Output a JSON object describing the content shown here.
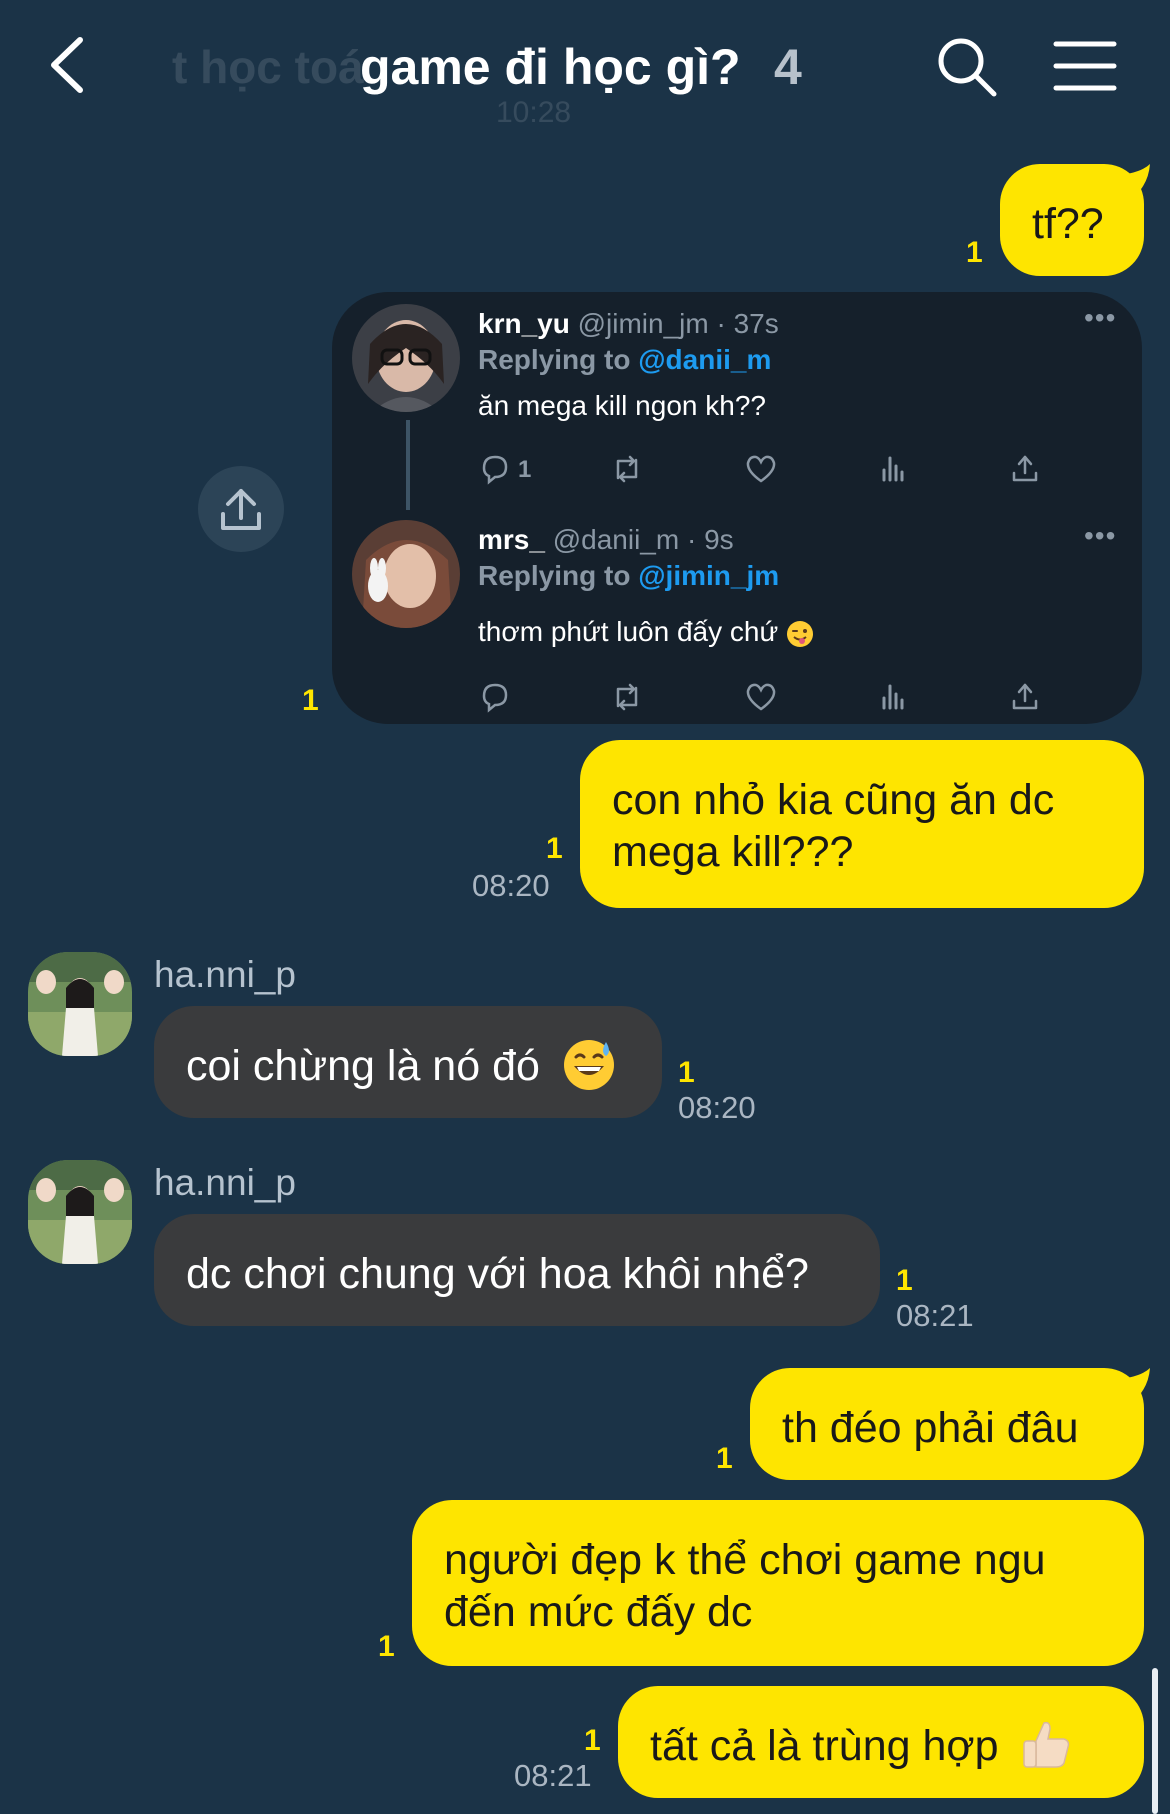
{
  "header": {
    "background_text": "t học toá",
    "background_time": "10:28",
    "title": "game đi học gì?",
    "member_count": "4",
    "back_icon": "chevron-left-icon",
    "search_icon": "search-icon",
    "menu_icon": "hamburger-menu-icon"
  },
  "colors": {
    "background": "#1b3347",
    "my_bubble": "#fee500",
    "their_bubble": "#3a3b3d",
    "unread": "#fee500"
  },
  "messages": {
    "m1": {
      "text": "tf??",
      "unread": "1"
    },
    "tweet": {
      "unread": "1",
      "t1": {
        "name": "krn_yu",
        "handle": "@jimin_jm · 37s",
        "replying_label": "Replying to",
        "replying_to": "@danii_m",
        "text": "ăn mega kill ngon kh??",
        "reply_count": "1"
      },
      "t2": {
        "name": "mrs_",
        "handle": "@danii_m · 9s",
        "replying_label": "Replying to",
        "replying_to": "@jimin_jm",
        "text": "thơm phứt luôn đấy chứ"
      }
    },
    "m2": {
      "line1": "con nhỏ kia cũng ăn dc",
      "line2": "mega kill???",
      "unread": "1",
      "time": "08:20"
    },
    "m3": {
      "sender": "ha.nni_p",
      "text": "coi chừng là nó đó",
      "unread": "1",
      "time": "08:20"
    },
    "m4": {
      "sender": "ha.nni_p",
      "text": "dc chơi chung với hoa khôi nhể?",
      "unread": "1",
      "time": "08:21"
    },
    "m5": {
      "text": "th đéo phải đâu",
      "unread": "1"
    },
    "m6": {
      "line1": "người đẹp k thể chơi game ngu",
      "line2": "đến mức đấy dc",
      "unread": "1"
    },
    "m7": {
      "text": "tất cả là trùng hợp",
      "unread": "1",
      "time": "08:21"
    }
  }
}
